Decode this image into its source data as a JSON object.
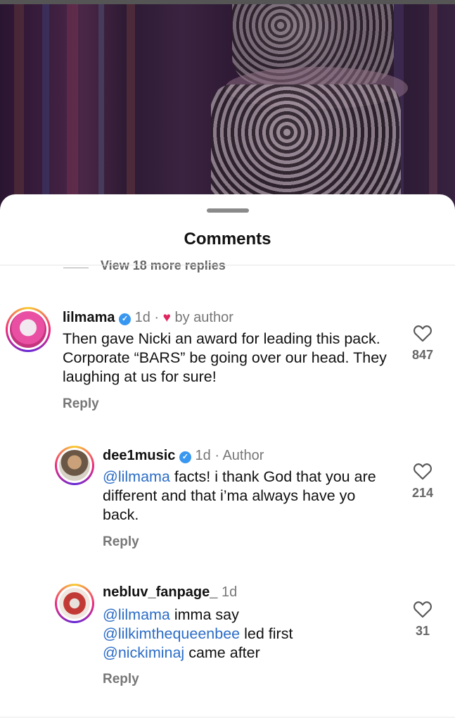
{
  "sheet": {
    "title": "Comments",
    "view_more_replies": "View 18 more replies"
  },
  "comments": [
    {
      "username": "lilmama",
      "verified": true,
      "time": "1d",
      "separator": "·",
      "badge": "by author",
      "text": "Then gave Nicki an award for leading this pack. Corporate “BARS” be going over our head. They laughing at us for sure!",
      "reply_label": "Reply",
      "likes": "847"
    },
    {
      "username": "dee1music",
      "verified": true,
      "time": "1d",
      "separator": "·",
      "badge": "Author",
      "mention": "@lilmama",
      "text": " facts! i thank God that you are different and that i’ma always have yo back.",
      "reply_label": "Reply",
      "likes": "214"
    },
    {
      "username": "nebluv_fanpage_",
      "verified": false,
      "time": "1d",
      "mention1": "@lilmama",
      "text1": " imma say ",
      "mention2": "@lilkimthequeenbee",
      "text2": "  led first ",
      "mention3": "@nickiminaj",
      "text3": " came after",
      "reply_label": "Reply",
      "likes": "31"
    }
  ],
  "colors": {
    "mention": "#2c6dc7",
    "verified": "#3897f0",
    "author_heart": "#e0245e"
  },
  "icons": [
    "heart-outline-icon",
    "verified-badge-icon",
    "author-heart-icon"
  ]
}
